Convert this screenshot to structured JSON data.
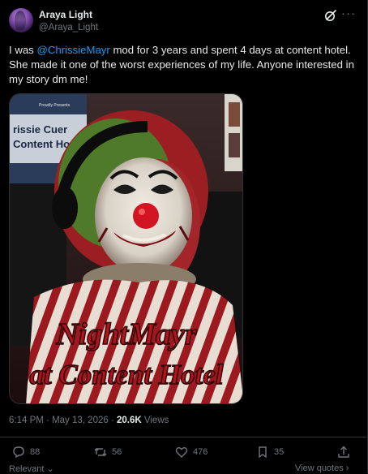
{
  "author": {
    "name": "Araya Light",
    "handle": "@Araya_Light"
  },
  "post": {
    "text_before": "I was ",
    "mention": "@ChrissieMayr",
    "text_after": " mod for 3 years and spent 4 days at content hotel. She made it one of the worst experiences of my life. Anyone interested in my story dm me!",
    "media": {
      "top_banner": "Proudly Presents",
      "poster_title": "rissie Cuer",
      "poster_subtitle": "Content Ho",
      "caption_line1": "NightMayr",
      "caption_line2": "at Content Hotel"
    },
    "time": "6:14 PM",
    "date": "May 13, 2026",
    "dot": "·",
    "views_count": "20.6K",
    "views_label": "Views"
  },
  "actions": {
    "replies": "88",
    "reposts": "56",
    "likes": "476",
    "bookmarks": "35"
  },
  "footer": {
    "relevant": "Relevant",
    "view_quotes": "View quotes"
  },
  "colors": {
    "background": "#000000",
    "accent": "#1d9bf0",
    "muted": "#71767b",
    "text": "#e7e9ea",
    "caption_red": "#b5121b"
  }
}
